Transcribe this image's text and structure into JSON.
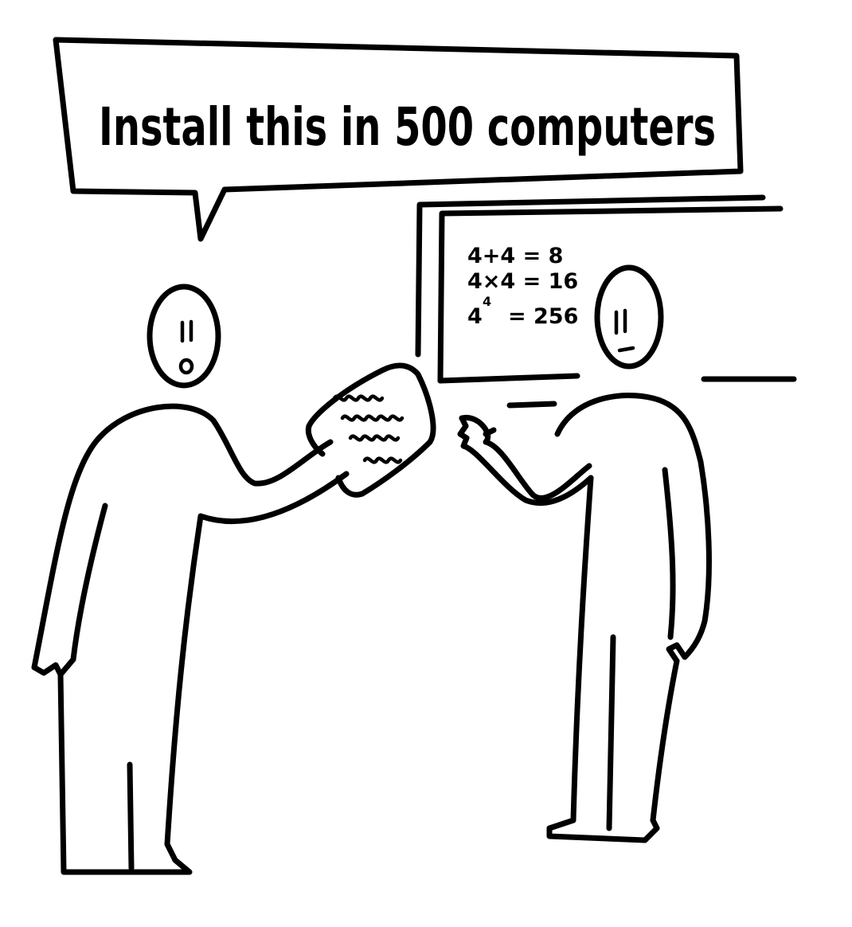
{
  "speech_bubble": {
    "text": "Install this in 500 computers"
  },
  "screen": {
    "lines": [
      "4+4 = 8",
      "4×4 = 16",
      "4",
      "= 256"
    ],
    "exponent": "4"
  },
  "colors": {
    "ink": "#000000",
    "paper": "#ffffff"
  }
}
